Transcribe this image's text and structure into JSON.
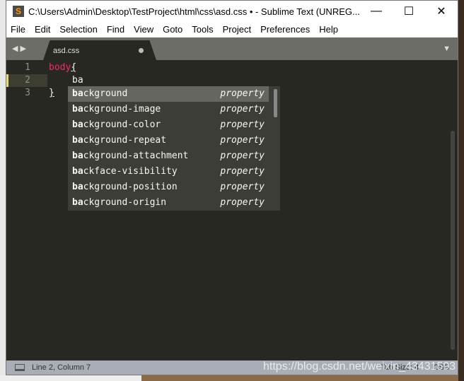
{
  "window": {
    "title": "C:\\Users\\Admin\\Desktop\\TestProject\\html\\css\\asd.css • - Sublime Text (UNREG...",
    "minimize": "—",
    "maximize": "☐",
    "close": "✕"
  },
  "menu": [
    "File",
    "Edit",
    "Selection",
    "Find",
    "View",
    "Goto",
    "Tools",
    "Project",
    "Preferences",
    "Help"
  ],
  "tab": {
    "label": "asd.css"
  },
  "editor": {
    "lines": [
      {
        "num": "1",
        "text": "body",
        "brace": "{"
      },
      {
        "num": "2",
        "text": "ba"
      },
      {
        "num": "3",
        "text": "}"
      }
    ]
  },
  "autocomplete": [
    {
      "prefix": "ba",
      "rest": "ckground",
      "type": "property"
    },
    {
      "prefix": "ba",
      "rest": "ckground-image",
      "type": "property"
    },
    {
      "prefix": "ba",
      "rest": "ckground-color",
      "type": "property"
    },
    {
      "prefix": "ba",
      "rest": "ckground-repeat",
      "type": "property"
    },
    {
      "prefix": "ba",
      "rest": "ckground-attachment",
      "type": "property"
    },
    {
      "prefix": "ba",
      "rest": "ckface-visibility",
      "type": "property"
    },
    {
      "prefix": "ba",
      "rest": "ckground-position",
      "type": "property"
    },
    {
      "prefix": "ba",
      "rest": "ckground-origin",
      "type": "property"
    }
  ],
  "status": {
    "position": "Line 2, Column 7",
    "tab_size": "Tab Size: 4",
    "syntax": "CSS"
  },
  "watermark": "https://blog.csdn.net/weixin_43431593"
}
